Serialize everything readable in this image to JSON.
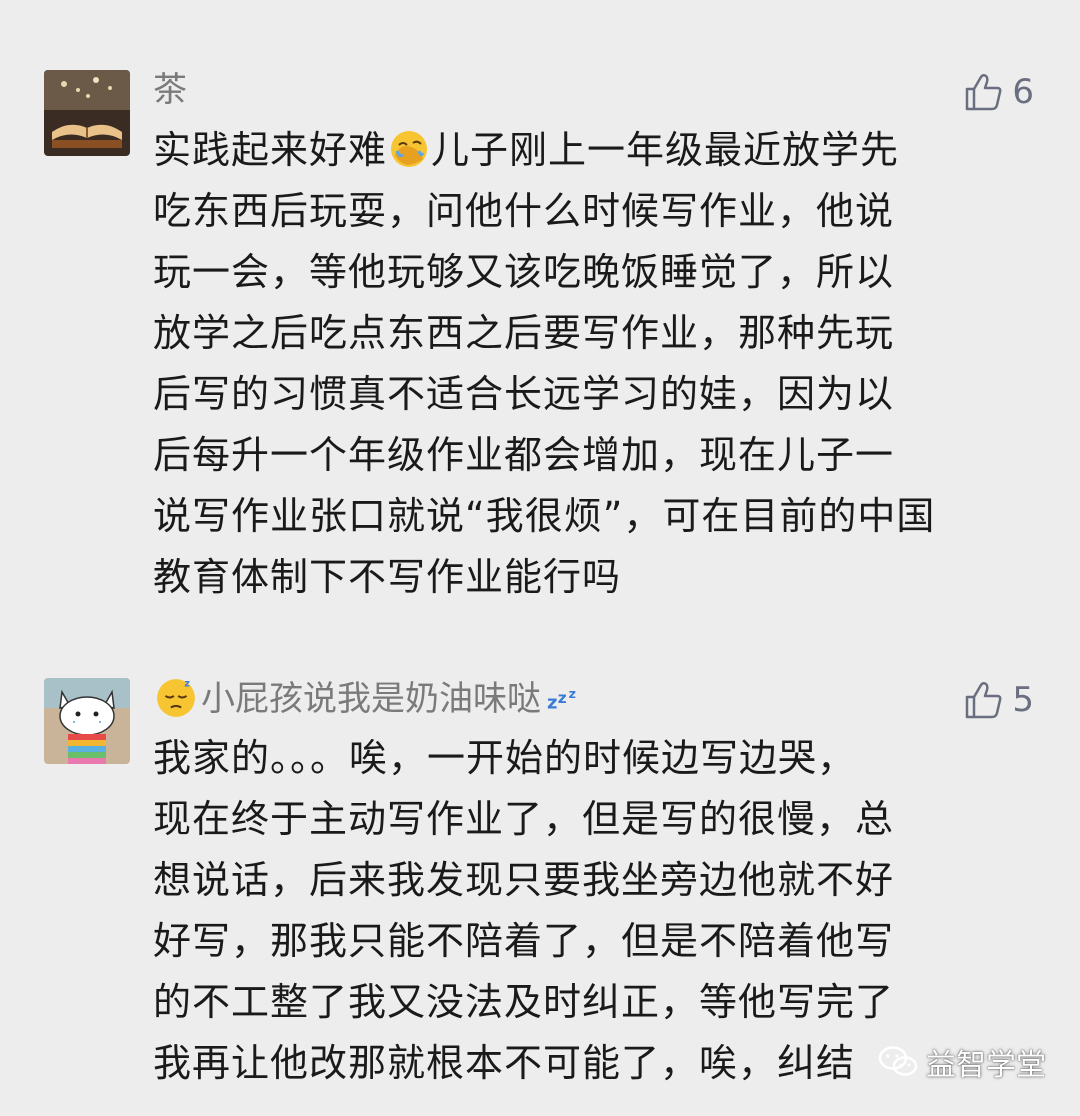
{
  "comments": [
    {
      "username": "茶",
      "avatar_icon": "open-book-avatar",
      "likes": "6",
      "body_lines": [
        [
          "实践起来好难",
          "儿子刚上一年级最近放学先"
        ],
        [
          "吃东西后玩耍，问他什么时候写作业，他说"
        ],
        [
          "玩一会，等他玩够又该吃晚饭睡觉了，所以"
        ],
        [
          "放学之后吃点东西之后要写作业，那种先玩"
        ],
        [
          "后写的习惯真不适合长远学习的娃，因为以"
        ],
        [
          "后每升一个年级作业都会增加，现在儿子一"
        ],
        [
          "说写作业张口就说“我很烦”，可在目前的中国"
        ],
        [
          "教育体制下不写作业能行吗"
        ]
      ],
      "inline_emoji": "facepalm-emoji"
    },
    {
      "username": "小屁孩说我是奶油味哒",
      "username_prefix_emoji": "sleepy-face-emoji",
      "username_suffix_emoji": "zzz-emoji",
      "avatar_icon": "cartoon-cat-avatar",
      "likes": "5",
      "body_lines": [
        [
          "我家的。。。唉，一开始的时候边写边哭，"
        ],
        [
          "现在终于主动写作业了，但是写的很慢，总"
        ],
        [
          "想说话，后来我发现只要我坐旁边他就不好"
        ],
        [
          "好写，那我只能不陪着了，但是不陪着他写"
        ],
        [
          "的不工整了我又没法及时纠正，等他写完了"
        ],
        [
          "我再让他改那就根本不可能了，唉，纠结"
        ]
      ]
    }
  ],
  "watermark": {
    "text": "益智学堂",
    "icon": "wechat-icon"
  },
  "colors": {
    "background": "#ededed",
    "username": "#7a7a7a",
    "like": "#6a6f80",
    "text": "#1a1a1a"
  }
}
